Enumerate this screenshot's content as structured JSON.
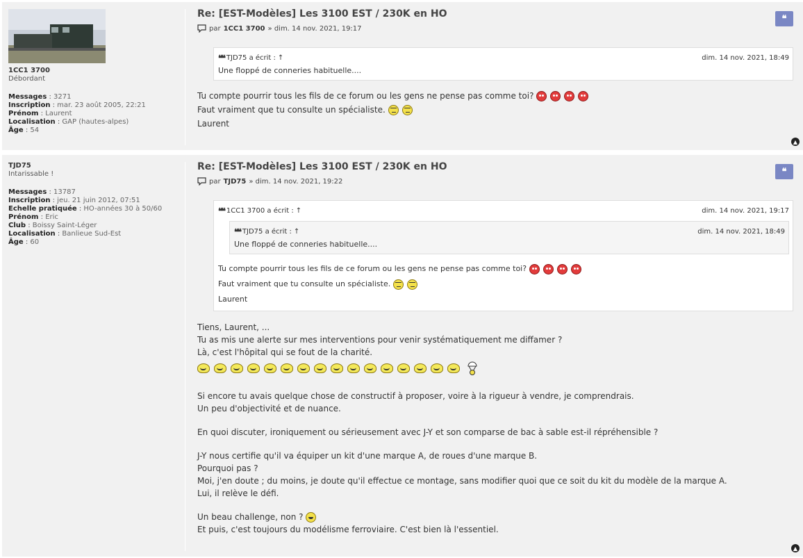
{
  "posts": [
    {
      "author": {
        "username": "1CC1 3700",
        "rank": "Débordant",
        "fields": [
          {
            "label": "Messages",
            "value": "3271"
          },
          {
            "label": "Inscription",
            "value": "mar. 23 août 2005, 22:21"
          },
          {
            "label": "Prénom",
            "value": "Laurent"
          },
          {
            "label": "Localisation",
            "value": "GAP (hautes-alpes)"
          },
          {
            "label": "Âge",
            "value": "54"
          }
        ]
      },
      "title": "Re: [EST-Modèles] Les 3100 EST / 230K en HO",
      "by": "par",
      "user": "1CC1 3700",
      "date": "» dim. 14 nov. 2021, 19:17",
      "quote": {
        "author": "TJD75 a écrit :",
        "arrow": "↑",
        "date": "dim. 14 nov. 2021, 18:49",
        "text": "Une floppé de conneries habituelle...."
      },
      "lines": [
        "Tu compte pourrir tous les fils de ce forum ou les gens ne pense pas comme toi?",
        "Faut vraiment que tu consulte un spécialiste.",
        "Laurent"
      ]
    },
    {
      "author": {
        "username": "TJD75",
        "rank": "Intarissable !",
        "fields": [
          {
            "label": "Messages",
            "value": "13787"
          },
          {
            "label": "Inscription",
            "value": "jeu. 21 juin 2012, 07:51"
          },
          {
            "label": "Echelle pratiquée",
            "value": "HO-années 30 à 50/60"
          },
          {
            "label": "Prénom",
            "value": "Eric"
          },
          {
            "label": "Club",
            "value": "Boissy Saint-Léger"
          },
          {
            "label": "Localisation",
            "value": "Banlieue Sud-Est"
          },
          {
            "label": "Âge",
            "value": "60"
          }
        ]
      },
      "title": "Re: [EST-Modèles] Les 3100 EST / 230K en HO",
      "by": "par",
      "user": "TJD75",
      "date": "» dim. 14 nov. 2021, 19:22",
      "quote": {
        "author": "1CC1 3700 a écrit :",
        "arrow": "↑",
        "date": "dim. 14 nov. 2021, 19:17",
        "nested": {
          "author": "TJD75 a écrit :",
          "arrow": "↑",
          "date": "dim. 14 nov. 2021, 18:49",
          "text": "Une floppé de conneries habituelle...."
        },
        "lines": [
          "Tu compte pourrir tous les fils de ce forum ou les gens ne pense pas comme toi?",
          "Faut vraiment que tu consulte un spécialiste.",
          "Laurent"
        ]
      },
      "lines": [
        "Tiens, Laurent, ...",
        "Tu as mis une alerte sur mes interventions pour venir systématiquement me diffamer ?",
        "Là, c'est l'hôpital qui se fout de la charité.",
        "Si encore tu avais quelque chose de constructif à proposer, voire à la rigueur à vendre, je comprendrais.",
        "Un peu d'objectivité et de nuance.",
        "En quoi discuter, ironiquement ou sérieusement avec J-Y et son comparse de bac à sable est-il répréhensible ?",
        "J-Y nous certifie qu'il va équiper un kit d'une marque A, de roues d'une marque B.",
        "Pourquoi pas ?",
        "Moi, j'en doute ; du moins, je doute qu'il effectue ce montage, sans modifier quoi que ce soit du kit du modèle de la marque A.",
        "Lui, il relève le défi.",
        "Un beau challenge, non ?",
        "Et puis, c'est toujours du modélisme ferroviaire. C'est bien là l'essentiel."
      ]
    }
  ],
  "icons": {
    "quote": "quote-icon",
    "post": "post-icon",
    "top": "back-to-top-icon"
  },
  "colors": {
    "post_bg": "#f1f1f1",
    "quote_button": "#7a87c4"
  }
}
